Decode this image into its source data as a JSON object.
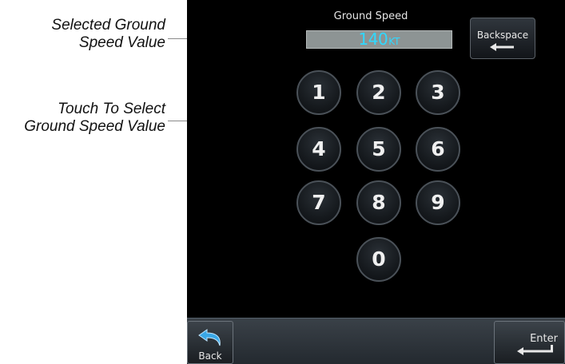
{
  "callouts": {
    "selected_value": [
      "Selected Ground",
      "Speed Value"
    ],
    "touch_select": [
      "Touch To Select",
      "Ground Speed Value"
    ]
  },
  "screen": {
    "title": "Ground Speed",
    "value": "140",
    "unit": "KT",
    "backspace_label": "Backspace",
    "keys": [
      "1",
      "2",
      "3",
      "4",
      "5",
      "6",
      "7",
      "8",
      "9",
      "0"
    ],
    "back_label": "Back",
    "enter_label": "Enter"
  },
  "colors": {
    "value_text": "#2fd8ff",
    "screen_bg": "#000000",
    "field_bg": "#8d9494"
  },
  "icons": {
    "backspace": "left-arrow-icon",
    "back": "return-arrow-icon",
    "enter": "enter-arrow-icon"
  }
}
